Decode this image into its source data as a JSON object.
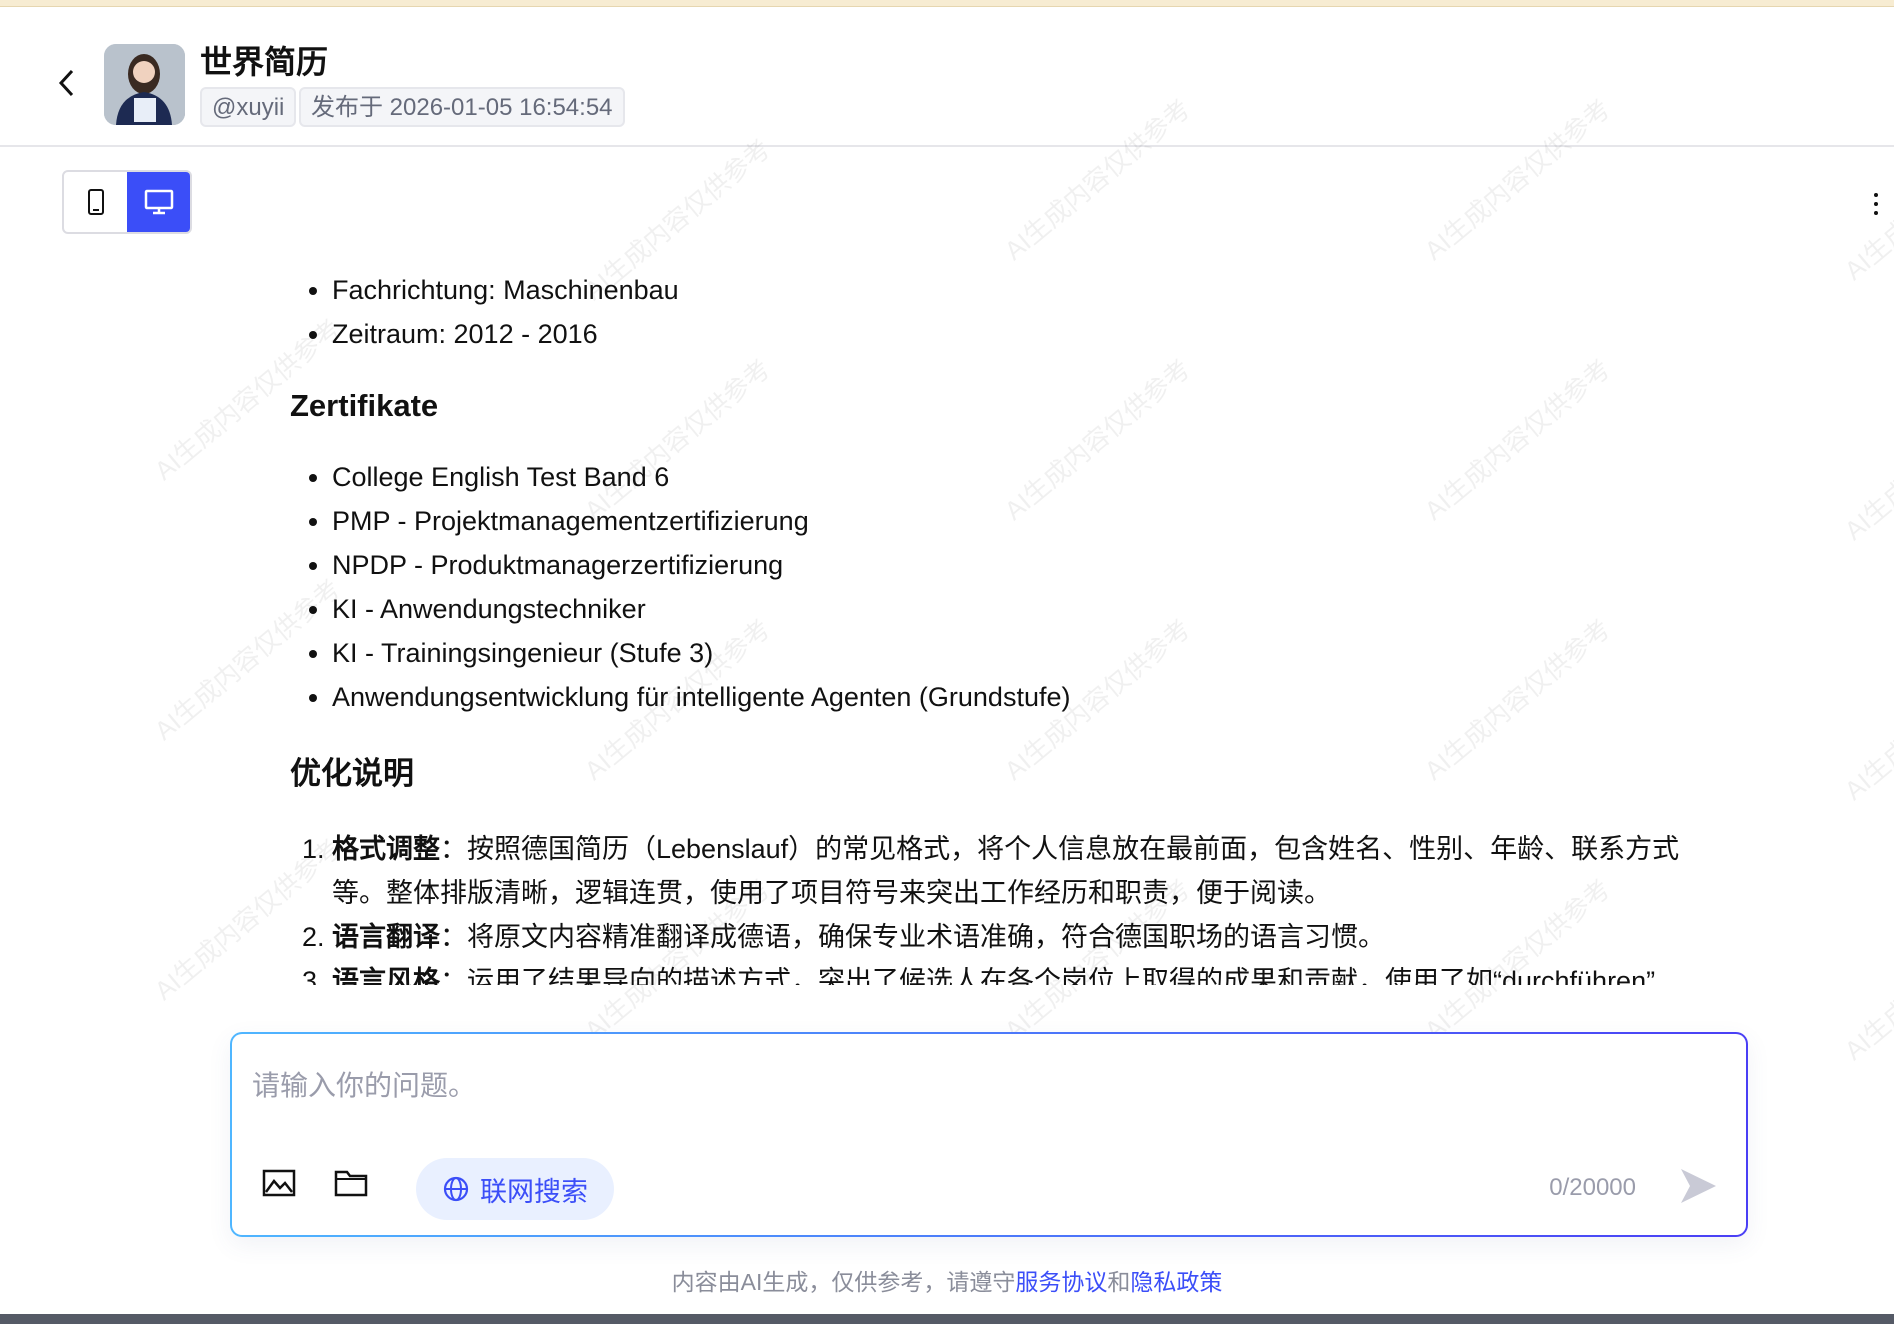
{
  "header": {
    "title": "世界简历",
    "username": "@xuyii",
    "published": "发布于 2026-01-05 16:54:54"
  },
  "watermark": "AI生成内容仅供参考",
  "content": {
    "bullets_top": [
      "Fachrichtung: Maschinenbau",
      "Zeitraum: 2012 - 2016"
    ],
    "cert_heading": "Zertifikate",
    "certs": [
      "College English Test Band 6",
      "PMP - Projektmanagementzertifizierung",
      "NPDP - Produktmanagerzertifizierung",
      "KI - Anwendungstechniker",
      "KI - Trainingsingenieur (Stufe 3)",
      "Anwendungsentwicklung für intelligente Agenten (Grundstufe)"
    ],
    "notes_heading": "优化说明",
    "notes": [
      {
        "label": "格式调整",
        "text": "：按照德国简历（Lebenslauf）的常见格式，将个人信息放在最前面，包含姓名、性别、年龄、联系方式等。整体排版清晰，逻辑连贯，使用了项目符号来突出工作经历和职责，便于阅读。"
      },
      {
        "label": "语言翻译",
        "text": "：将原文内容精准翻译成德语，确保专业术语准确，符合德国职场的语言习惯。"
      },
      {
        "label": "语言风格",
        "text": "：运用了结果导向的描述方式，突出了候选人在各个岗位上取得的成果和贡献，使用了如“durchführen”"
      }
    ]
  },
  "input": {
    "placeholder": "请输入你的问题。",
    "web_search": "联网搜索",
    "count": "0/20000"
  },
  "footer": {
    "text": "内容由AI生成，仅供参考，请遵守",
    "terms": "服务协议",
    "and": "和",
    "privacy": "隐私政策"
  },
  "colors": {
    "accent": "#3b4ef8"
  }
}
